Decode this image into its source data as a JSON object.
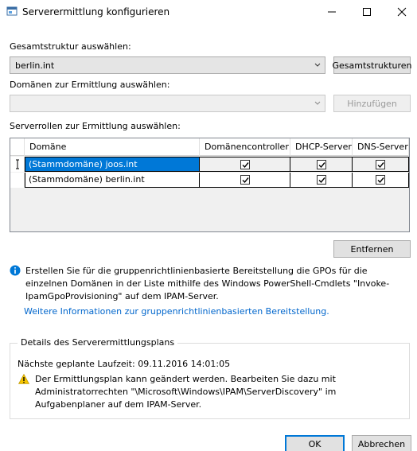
{
  "window": {
    "title": "Serverermittlung konfigurieren"
  },
  "forest": {
    "label": "Gesamtstruktur auswählen:",
    "value": "berlin.int",
    "button": "Gesamtstrukturen"
  },
  "domains": {
    "label": "Domänen zur Ermittlung auswählen:",
    "value": "",
    "button": "Hinzufügen"
  },
  "roles": {
    "label": "Serverrollen zur Ermittlung auswählen:",
    "columns": [
      "Domäne",
      "Domänencontroller",
      "DHCP-Server",
      "DNS-Server"
    ],
    "rows": [
      {
        "domain": "(Stammdomäne) joos.int",
        "dc": true,
        "dhcp": true,
        "dns": true,
        "selected": true
      },
      {
        "domain": "(Stammdomäne) berlin.int",
        "dc": true,
        "dhcp": true,
        "dns": true,
        "selected": false
      }
    ],
    "remove_button": "Entfernen"
  },
  "info": {
    "text": "Erstellen Sie für die gruppenrichtlinienbasierte Bereitstellung die GPOs für die einzelnen Domänen in der Liste mithilfe des Windows PowerShell-Cmdlets \"Invoke-IpamGpoProvisioning\" auf dem IPAM-Server.",
    "link": "Weitere Informationen zur gruppenrichtlinienbasierten Bereitstellung."
  },
  "plan": {
    "title": "Details des Serverermittlungsplans",
    "next_run": "Nächste geplante Laufzeit: 09.11.2016 14:01:05",
    "warning": "Der Ermittlungsplan kann geändert werden. Bearbeiten Sie dazu mit Administratorrechten \"\\Microsoft\\Windows\\IPAM\\ServerDiscovery\" im Aufgabenplaner auf dem IPAM-Server."
  },
  "footer": {
    "ok": "OK",
    "cancel": "Abbrechen"
  },
  "colors": {
    "accent": "#0078d7",
    "link": "#0066cc",
    "warning": "#f5c400"
  }
}
